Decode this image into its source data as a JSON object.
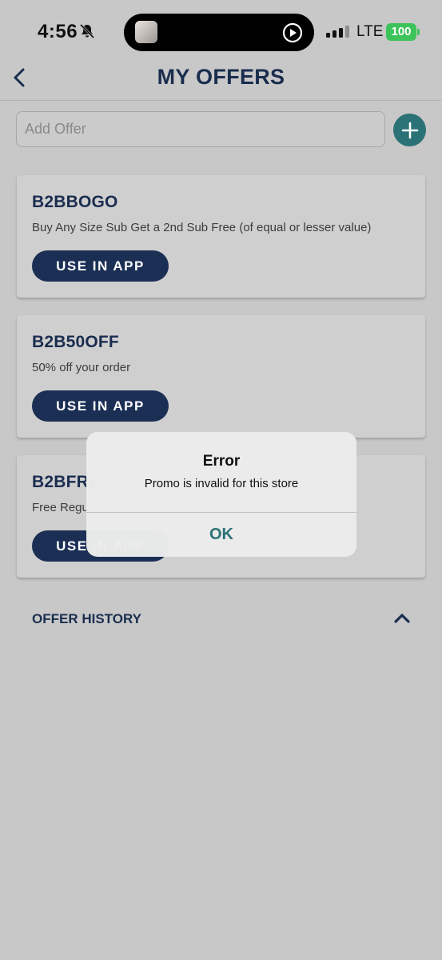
{
  "status_bar": {
    "time": "4:56",
    "network": "LTE",
    "battery": "100"
  },
  "header": {
    "title": "MY OFFERS"
  },
  "add_offer": {
    "placeholder": "Add Offer"
  },
  "offers": [
    {
      "code": "B2BBOGO",
      "description": "Buy Any Size Sub Get a 2nd Sub Free (of equal or lesser value)",
      "button": "USE IN APP"
    },
    {
      "code": "B2B50OFF",
      "description": "50% off your order",
      "button": "USE IN APP"
    },
    {
      "code": "B2BFRE",
      "description": "Free Regu",
      "button": "USE IN APP"
    }
  ],
  "offer_history": {
    "label": "OFFER HISTORY"
  },
  "alert": {
    "title": "Error",
    "message": "Promo is invalid for this store",
    "ok_label": "OK"
  },
  "colors": {
    "brand_navy": "#1b2f55",
    "accent_teal": "#2a7275",
    "battery_green": "#3cc35a"
  }
}
